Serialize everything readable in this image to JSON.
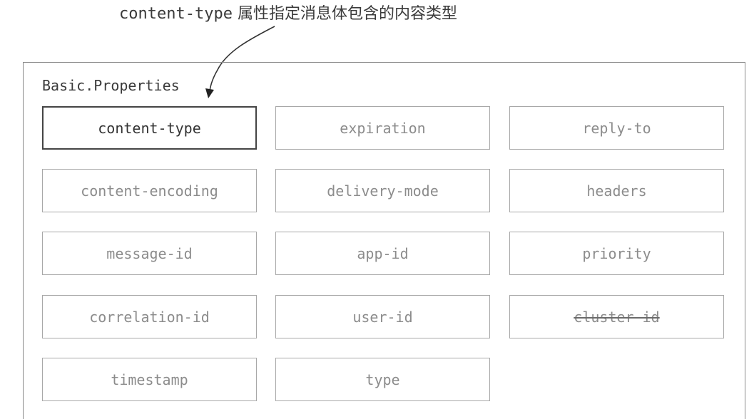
{
  "caption": {
    "code": "content-type",
    "text": " 属性指定消息体包含的内容类型"
  },
  "frame": {
    "title": "Basic.Properties"
  },
  "properties": [
    {
      "label": "content-type",
      "highlight": true,
      "deprecated": false
    },
    {
      "label": "expiration",
      "highlight": false,
      "deprecated": false
    },
    {
      "label": "reply-to",
      "highlight": false,
      "deprecated": false
    },
    {
      "label": "content-encoding",
      "highlight": false,
      "deprecated": false
    },
    {
      "label": "delivery-mode",
      "highlight": false,
      "deprecated": false
    },
    {
      "label": "headers",
      "highlight": false,
      "deprecated": false
    },
    {
      "label": "message-id",
      "highlight": false,
      "deprecated": false
    },
    {
      "label": "app-id",
      "highlight": false,
      "deprecated": false
    },
    {
      "label": "priority",
      "highlight": false,
      "deprecated": false
    },
    {
      "label": "correlation-id",
      "highlight": false,
      "deprecated": false
    },
    {
      "label": "user-id",
      "highlight": false,
      "deprecated": false
    },
    {
      "label": "cluster-id",
      "highlight": false,
      "deprecated": true
    },
    {
      "label": "timestamp",
      "highlight": false,
      "deprecated": false
    },
    {
      "label": "type",
      "highlight": false,
      "deprecated": false
    }
  ],
  "colors": {
    "highlight_border": "#444444",
    "normal_border": "#a8a8a8",
    "normal_text": "#8c8c8c",
    "dark_text": "#333333"
  }
}
